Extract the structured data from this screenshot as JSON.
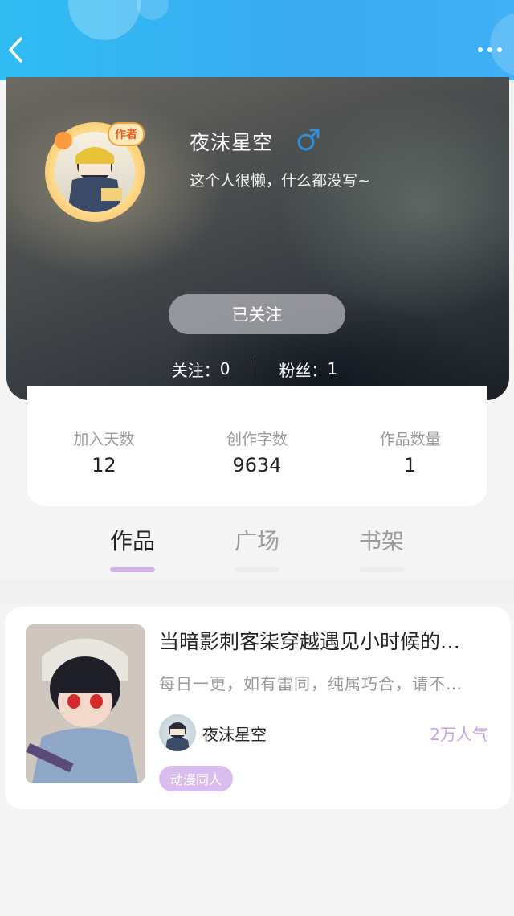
{
  "nav": {
    "back_icon": "chevron-left-icon",
    "more_icon": "more-dots-icon"
  },
  "profile": {
    "username": "夜沫星空",
    "gender_icon": "male-icon",
    "bio": "这个人很懒，什么都没写~",
    "author_badge": "作者",
    "follow_button": "已关注",
    "following_label": "关注：",
    "following_count": "0",
    "fans_label": "粉丝：",
    "fans_count": "1"
  },
  "stats": [
    {
      "label": "加入天数",
      "value": "12"
    },
    {
      "label": "创作字数",
      "value": "9634"
    },
    {
      "label": "作品数量",
      "value": "1"
    }
  ],
  "tabs": [
    {
      "label": "作品",
      "active": true
    },
    {
      "label": "广场",
      "active": false
    },
    {
      "label": "书架",
      "active": false
    }
  ],
  "works": [
    {
      "title": "当暗影刺客柒穿越遇见小时候的…",
      "description": "每日一更，如有雷同，纯属巧合，请不…",
      "author": "夜沫星空",
      "popularity": "2万人气",
      "tag": "动漫同人"
    }
  ],
  "colors": {
    "header_blue": "#2fbdf2",
    "accent_purple": "#cfb2e8",
    "popularity_purple": "#c6a3e8",
    "gender_blue": "#2f8fd8"
  }
}
